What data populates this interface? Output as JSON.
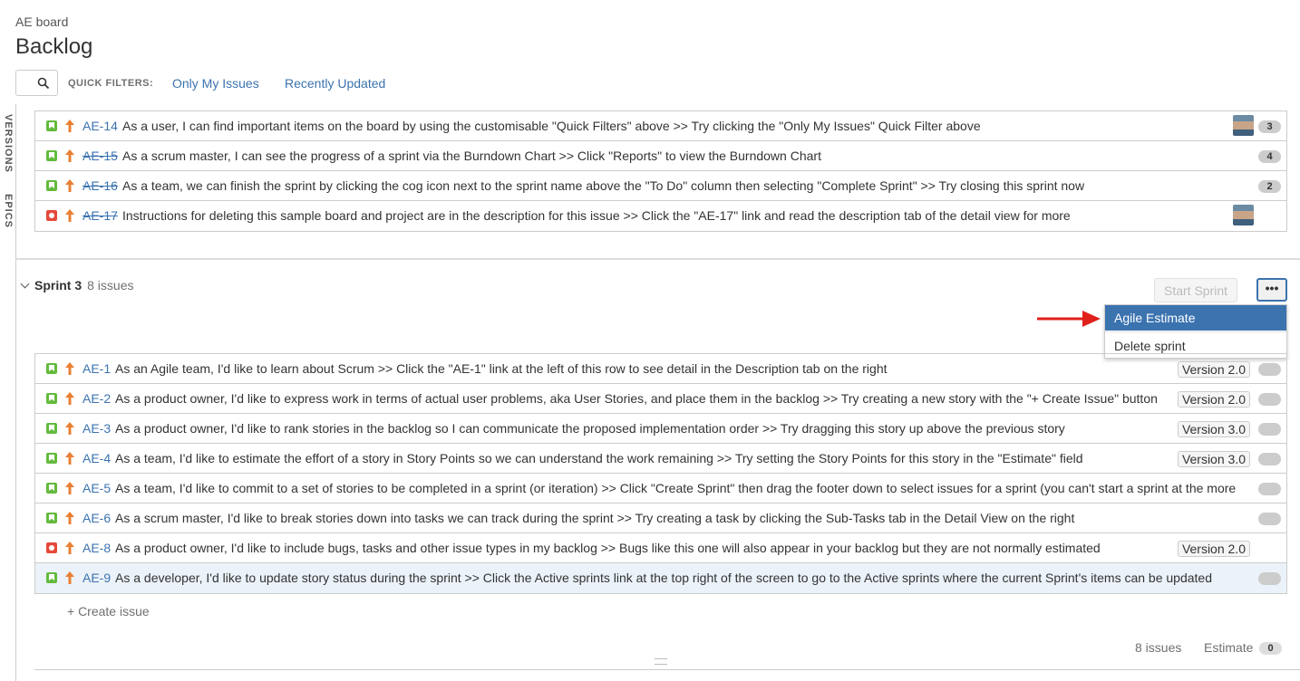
{
  "header": {
    "board_name": "AE board",
    "title": "Backlog"
  },
  "quick_filters": {
    "label": "QUICK FILTERS:",
    "items": [
      "Only My Issues",
      "Recently Updated"
    ]
  },
  "side_tabs": [
    "VERSIONS",
    "EPICS"
  ],
  "top_issues": [
    {
      "key": "AE-14",
      "done": false,
      "type": "story",
      "summary": "As a user, I can find important items on the board by using the customisable \"Quick Filters\" above >> Try clicking the \"Only My Issues\" Quick Filter above",
      "avatar": true,
      "points": "3"
    },
    {
      "key": "AE-15",
      "done": true,
      "type": "story",
      "summary": "As a scrum master, I can see the progress of a sprint via the Burndown Chart >> Click \"Reports\" to view the Burndown Chart",
      "avatar": false,
      "points": "4"
    },
    {
      "key": "AE-16",
      "done": true,
      "type": "story",
      "summary": "As a team, we can finish the sprint by clicking the cog icon next to the sprint name above the \"To Do\" column then selecting \"Complete Sprint\" >> Try closing this sprint now",
      "avatar": false,
      "points": "2"
    },
    {
      "key": "AE-17",
      "done": true,
      "type": "bug",
      "summary": "Instructions for deleting this sample board and project are in the description for this issue >> Click the \"AE-17\" link and read the description tab of the detail view for more",
      "avatar": true,
      "points": ""
    }
  ],
  "sprint": {
    "name": "Sprint 3",
    "count": "8 issues",
    "start_button": "Start Sprint",
    "more_button": "•••",
    "menu": [
      "Agile Estimate",
      "Delete sprint"
    ],
    "issues": [
      {
        "key": "AE-1",
        "type": "story",
        "summary": "As an Agile team, I'd like to learn about Scrum >> Click the \"AE-1\" link at the left of this row to see detail in the Description tab on the right",
        "version": "Version 2.0",
        "selected": false
      },
      {
        "key": "AE-2",
        "type": "story",
        "summary": "As a product owner, I'd like to express work in terms of actual user problems, aka User Stories, and place them in the backlog >> Try creating a new story with the \"+ Create Issue\" button",
        "version": "Version 2.0",
        "selected": false
      },
      {
        "key": "AE-3",
        "type": "story",
        "summary": "As a product owner, I'd like to rank stories in the backlog so I can communicate the proposed implementation order >> Try dragging this story up above the previous story",
        "version": "Version 3.0",
        "selected": false
      },
      {
        "key": "AE-4",
        "type": "story",
        "summary": "As a team, I'd like to estimate the effort of a story in Story Points so we can understand the work remaining >> Try setting the Story Points for this story in the \"Estimate\" field",
        "version": "Version 3.0",
        "selected": false
      },
      {
        "key": "AE-5",
        "type": "story",
        "summary": "As a team, I'd like to commit to a set of stories to be completed in a sprint (or iteration) >> Click \"Create Sprint\" then drag the footer down to select issues for a sprint (you can't start a sprint at the more",
        "version": "",
        "selected": false
      },
      {
        "key": "AE-6",
        "type": "story",
        "summary": "As a scrum master, I'd like to break stories down into tasks we can track during the sprint >> Try creating a task by clicking the Sub-Tasks tab in the Detail View on the right",
        "version": "",
        "selected": false
      },
      {
        "key": "AE-8",
        "type": "bug",
        "summary": "As a product owner, I'd like to include bugs, tasks and other issue types in my backlog >> Bugs like this one will also appear in your backlog but they are not normally estimated",
        "version": "Version 2.0",
        "selected": false,
        "no_estimate": true
      },
      {
        "key": "AE-9",
        "type": "story",
        "summary": "As a developer, I'd like to update story status during the sprint >> Click the Active sprints link at the top right of the screen to go to the Active sprints where the current Sprint's items can be updated",
        "version": "",
        "selected": true
      }
    ],
    "create_issue": "+   Create issue",
    "footer": {
      "count": "8 issues",
      "estimate_label": "Estimate",
      "estimate_value": "0"
    }
  }
}
